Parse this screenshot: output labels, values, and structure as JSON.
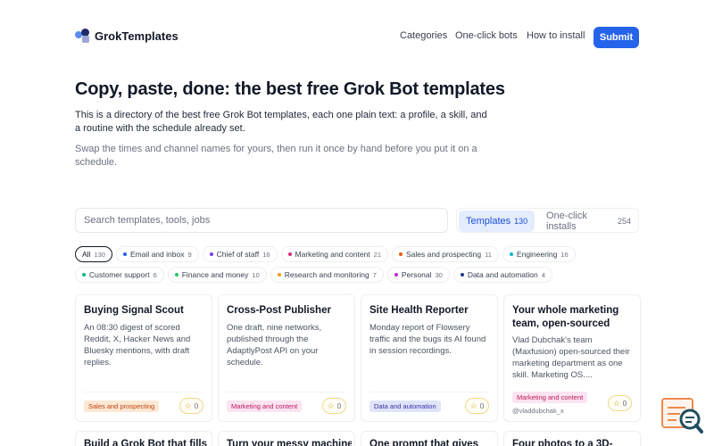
{
  "header": {
    "logo_text": "GrokTemplates",
    "nav": [
      "Categories",
      "One-click bots",
      "How to install"
    ],
    "submit_label": "Submit"
  },
  "hero": {
    "title": "Copy, paste, done: the best free Grok Bot templates",
    "lead": "This is a directory of the best free Grok Bot templates, each one plain text: a profile, a skill, and a routine with the schedule already set.",
    "sub": "Swap the times and channel names for yours, then run it once by hand before you put it on a schedule."
  },
  "search": {
    "placeholder": "Search templates, tools, jobs",
    "tabs": [
      {
        "label": "Templates",
        "count": "130"
      },
      {
        "label": "One-click installs",
        "count": "254"
      }
    ]
  },
  "chips": [
    {
      "label": "All",
      "count": "130",
      "color": ""
    },
    {
      "label": "Email and inbox",
      "count": "9",
      "color": "#2563eb"
    },
    {
      "label": "Chief of staff",
      "count": "16",
      "color": "#7c3aed"
    },
    {
      "label": "Marketing and content",
      "count": "21",
      "color": "#db2777"
    },
    {
      "label": "Sales and prospecting",
      "count": "11",
      "color": "#ea580c"
    },
    {
      "label": "Engineering",
      "count": "16",
      "color": "#06b6d4"
    },
    {
      "label": "Customer support",
      "count": "6",
      "color": "#10b981"
    },
    {
      "label": "Finance and money",
      "count": "10",
      "color": "#22c55e"
    },
    {
      "label": "Research and monitoring",
      "count": "7",
      "color": "#f59e0b"
    },
    {
      "label": "Personal",
      "count": "30",
      "color": "#c026d3"
    },
    {
      "label": "Data and automation",
      "count": "4",
      "color": "#1e3a8a"
    }
  ],
  "cards": [
    {
      "title": "Buying Signal Scout",
      "desc": "An 08:30 digest of scored Reddit, X, Hacker News and Bluesky mentions, with draft replies.",
      "tag": "Sales and prospecting",
      "tag_bg": "#fde8d4",
      "tag_color": "#c2410c",
      "stars": "0",
      "author": ""
    },
    {
      "title": "Cross-Post Publisher",
      "desc": "One draft, nine networks, published through the AdaptlyPost API on your schedule.",
      "tag": "Marketing and content",
      "tag_bg": "#fce4f0",
      "tag_color": "#be185d",
      "stars": "0",
      "author": ""
    },
    {
      "title": "Site Health Reporter",
      "desc": "Monday report of Flowsery traffic and the bugs its AI found in session recordings.",
      "tag": "Data and automation",
      "tag_bg": "#e0e4fb",
      "tag_color": "#3730a3",
      "stars": "0",
      "author": ""
    },
    {
      "title": "Your whole marketing team, open-sourced",
      "desc": "Vlad Dubchak's team (Maxfusion) open-sourced their marketing department as one skill. Marketing OS....",
      "tag": "Marketing and content",
      "tag_bg": "#fce4f0",
      "tag_color": "#be185d",
      "stars": "0",
      "author": "@vladdubchak_x"
    }
  ],
  "cards_row2": [
    {
      "title": "Build a Grok Bot that fills"
    },
    {
      "title": "Turn your messy machine"
    },
    {
      "title": "One prompt that gives"
    },
    {
      "title": "Four photos to a 3D-"
    }
  ]
}
